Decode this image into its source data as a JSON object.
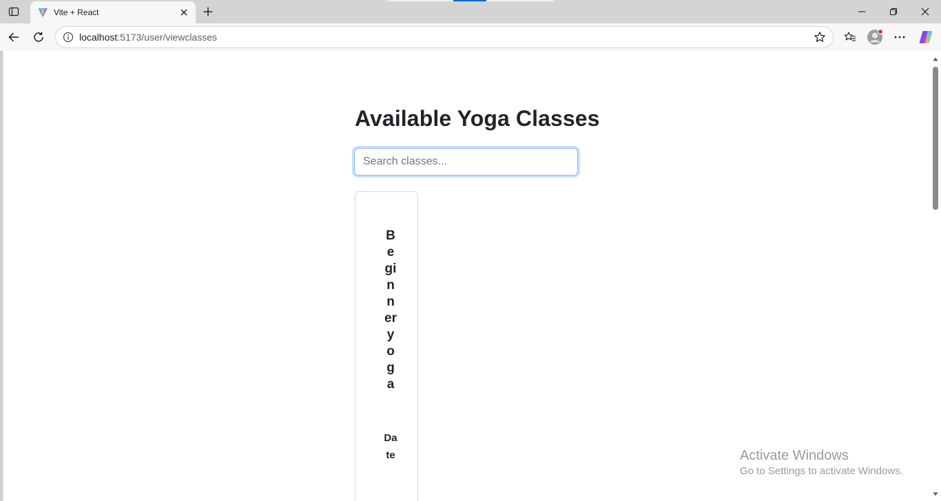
{
  "browser": {
    "tab": {
      "title": "Vite + React"
    },
    "address": {
      "host": "localhost",
      "path": ":5173/user/viewclasses"
    },
    "icons": {
      "tab_actions": "tab-actions-icon",
      "favicon": "vite-logo-icon",
      "close": "close-icon",
      "new_tab": "plus-icon",
      "minimize": "minimize-icon",
      "restore": "restore-icon",
      "close_window": "close-icon",
      "back": "back-arrow-icon",
      "refresh": "refresh-icon",
      "info": "info-icon",
      "favorite": "star-icon",
      "favorites": "favorites-icon",
      "profile": "profile-avatar-icon",
      "more": "more-icon",
      "copilot": "copilot-icon"
    },
    "colors": {
      "accent": "#0067c0"
    }
  },
  "page": {
    "title": "Available Yoga Classes",
    "search": {
      "placeholder": "Search classes...",
      "value": ""
    },
    "classes": [
      {
        "name": "Beginneryoga",
        "meta": "Date"
      }
    ]
  },
  "watermark": {
    "line1": "Activate Windows",
    "line2": "Go to Settings to activate Windows."
  }
}
